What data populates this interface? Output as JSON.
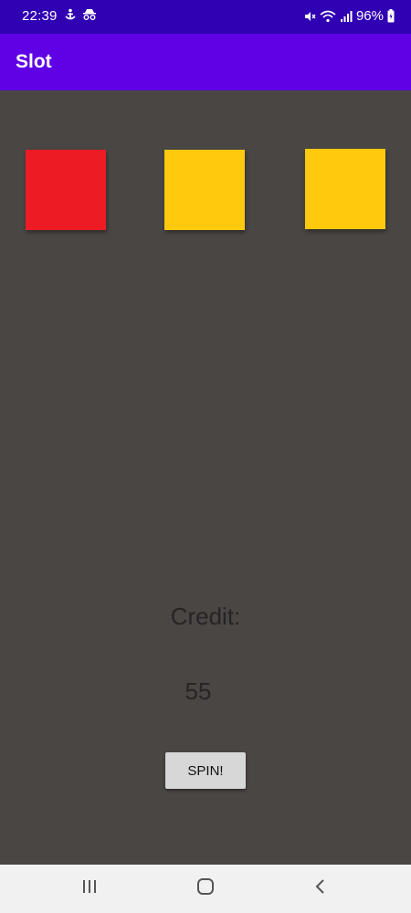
{
  "status_bar": {
    "time": "22:39",
    "battery": "96%",
    "left_icons": [
      "accessibility-icon",
      "incognito-icon"
    ],
    "right_icons": [
      "mute-icon",
      "wifi-icon",
      "signal-icon",
      "battery-icon"
    ]
  },
  "app_bar": {
    "title": "Slot"
  },
  "reels": [
    {
      "color": "#ed1c24"
    },
    {
      "color": "#ffc90e"
    },
    {
      "color": "#ffc90e"
    }
  ],
  "credit": {
    "label": "Credit:",
    "value": "55"
  },
  "spin_button": {
    "label": "SPIN!"
  },
  "nav_bar": {
    "buttons": [
      "recents-icon",
      "home-icon",
      "back-icon"
    ]
  },
  "colors": {
    "status_bar": "#3000b3",
    "app_bar": "#5f00e5",
    "background": "#494644",
    "nav_bar": "#f1f1f1"
  }
}
